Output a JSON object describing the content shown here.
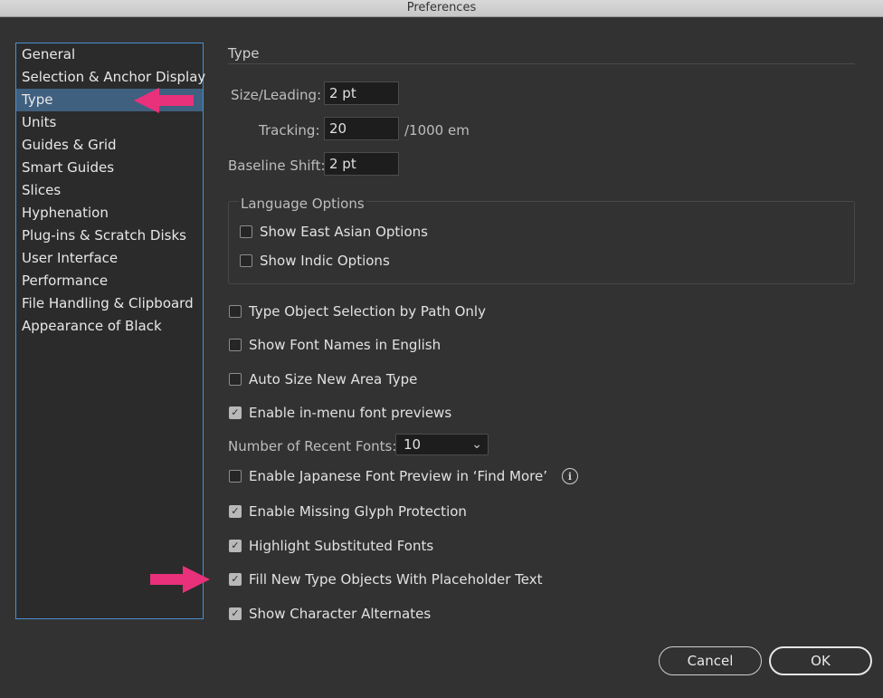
{
  "window": {
    "title": "Preferences"
  },
  "sidebar": {
    "items": [
      {
        "label": "General"
      },
      {
        "label": "Selection & Anchor Display"
      },
      {
        "label": "Type",
        "selected": true
      },
      {
        "label": "Units"
      },
      {
        "label": "Guides & Grid"
      },
      {
        "label": "Smart Guides"
      },
      {
        "label": "Slices"
      },
      {
        "label": "Hyphenation"
      },
      {
        "label": "Plug-ins & Scratch Disks"
      },
      {
        "label": "User Interface"
      },
      {
        "label": "Performance"
      },
      {
        "label": "File Handling & Clipboard"
      },
      {
        "label": "Appearance of Black"
      }
    ]
  },
  "main": {
    "section_title": "Type",
    "size_leading": {
      "label": "Size/Leading:",
      "value": "2 pt"
    },
    "tracking": {
      "label": "Tracking:",
      "value": "20",
      "unit": "/1000 em"
    },
    "baseline_shift": {
      "label": "Baseline Shift:",
      "value": "2 pt"
    },
    "language_options": {
      "title": "Language Options",
      "items": [
        {
          "label": "Show East Asian Options",
          "checked": false
        },
        {
          "label": "Show Indic Options",
          "checked": false
        }
      ]
    },
    "checkboxes": [
      {
        "label": "Type Object Selection by Path Only",
        "checked": false
      },
      {
        "label": "Show Font Names in English",
        "checked": false
      },
      {
        "label": "Auto Size New Area Type",
        "checked": false
      },
      {
        "label": "Enable in-menu font previews",
        "checked": true
      }
    ],
    "recent_fonts": {
      "label": "Number of Recent Fonts:",
      "value": "10"
    },
    "checkboxes2": [
      {
        "label": "Enable Japanese Font Preview in ‘Find More’",
        "checked": false
      },
      {
        "label": "Enable Missing Glyph Protection",
        "checked": true
      },
      {
        "label": "Highlight Substituted Fonts",
        "checked": true
      },
      {
        "label": "Fill New Type Objects With Placeholder Text",
        "checked": true
      },
      {
        "label": "Show Character Alternates",
        "checked": true
      }
    ]
  },
  "buttons": {
    "cancel": "Cancel",
    "ok": "OK"
  },
  "colors": {
    "accent_arrow": "#e8317a",
    "selection": "#40607f",
    "focus_border": "#4a8fd0"
  }
}
